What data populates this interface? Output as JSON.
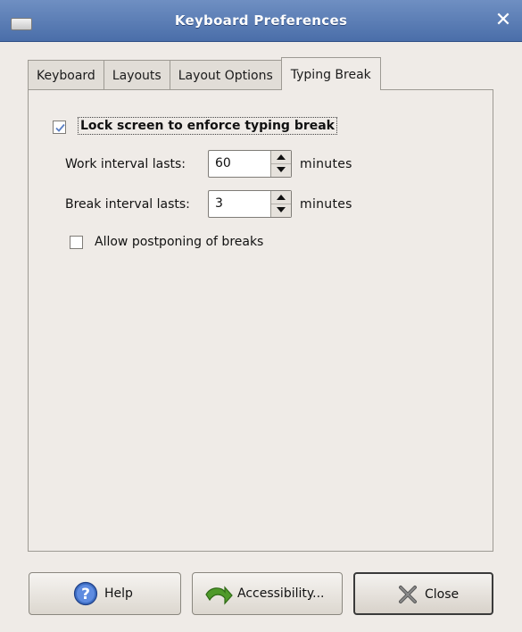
{
  "window": {
    "title": "Keyboard Preferences",
    "close_glyph": "✕"
  },
  "tabs": [
    {
      "label": "Keyboard"
    },
    {
      "label": "Layouts"
    },
    {
      "label": "Layout Options"
    },
    {
      "label": "Typing Break",
      "active": true
    }
  ],
  "typing_break": {
    "lock_screen": {
      "label": "Lock screen to enforce typing break",
      "checked": true
    },
    "work_interval": {
      "label": "Work interval lasts:",
      "value": "60",
      "unit": "minutes"
    },
    "break_interval": {
      "label": "Break interval lasts:",
      "value": "3",
      "unit": "minutes"
    },
    "allow_postponing": {
      "label": "Allow postponing of breaks",
      "checked": false
    }
  },
  "buttons": {
    "help": "Help",
    "accessibility": "Accessibility...",
    "close": "Close"
  },
  "colors": {
    "titlebar": "#4a6ea9",
    "background": "#efebe7",
    "check": "#5b7fc4"
  },
  "icons": {
    "window_menu": "window-menu-icon",
    "close": "close-icon",
    "help": "help-icon",
    "accessibility": "accessibility-arrow-icon",
    "close_button": "close-x-icon"
  }
}
